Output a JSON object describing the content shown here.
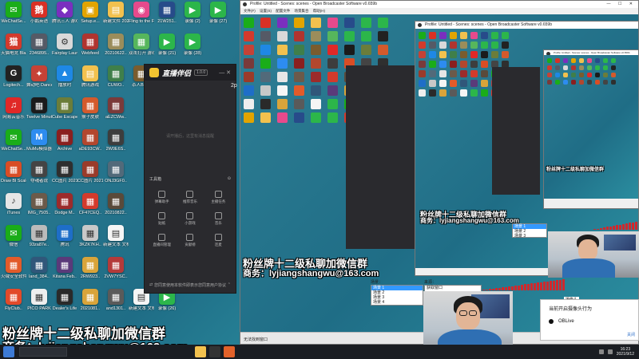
{
  "desktop_icons": [
    {
      "label": "WeChatSe...",
      "color": "#1aad19",
      "glyph": "✉",
      "col": 0,
      "row": 0
    },
    {
      "label": "小鹅英语",
      "color": "#d93025",
      "glyph": "鹅",
      "col": 1,
      "row": 0
    },
    {
      "label": "腾讯三人 游戏 (2)",
      "color": "#7a2fbf",
      "glyph": "◆",
      "col": 2,
      "row": 0
    },
    {
      "label": "Setup.e...",
      "color": "#e2a400",
      "glyph": "▣",
      "col": 3,
      "row": 0
    },
    {
      "label": "新建文件 2021062...",
      "color": "#f2c14e",
      "glyph": "▤",
      "col": 4,
      "row": 0
    },
    {
      "label": "Fling to the Finish 2...",
      "color": "#e64a8c",
      "glyph": "◉",
      "col": 5,
      "row": 0
    },
    {
      "label": "21W251..",
      "color": "#274b8a",
      "glyph": "▦",
      "col": 6,
      "row": 0
    },
    {
      "label": "录像 (2)",
      "color": "#2cb64a",
      "glyph": "▶",
      "col": 7,
      "row": 0
    },
    {
      "label": "录像 (27)",
      "color": "#2cb64a",
      "glyph": "▶",
      "col": 8,
      "row": 0
    },
    {
      "label": "天猫电竞 Blazing...",
      "color": "#d33a2c",
      "glyph": "猫",
      "col": 0,
      "row": 1
    },
    {
      "label": "2346895..",
      "color": "#555a66",
      "glyph": "▦",
      "col": 1,
      "row": 1
    },
    {
      "label": "Fairplay Launcher v...",
      "color": "#d9d9d9",
      "glyph": "⚙",
      "col": 2,
      "row": 1
    },
    {
      "label": "Webfeed",
      "color": "#b0342f",
      "glyph": "▦",
      "col": 3,
      "row": 1
    },
    {
      "label": "20210622..",
      "color": "#9b8d5b",
      "glyph": "▦",
      "col": 4,
      "row": 1
    },
    {
      "label": "双击打开 游戏...",
      "color": "#56b65c",
      "glyph": "▦",
      "col": 5,
      "row": 1
    },
    {
      "label": "录像 (21)",
      "color": "#2cb64a",
      "glyph": "▶",
      "col": 6,
      "row": 1
    },
    {
      "label": "录像 (28)",
      "color": "#2cb64a",
      "glyph": "▶",
      "col": 7,
      "row": 1
    },
    {
      "label": "Logitech...",
      "color": "#222222",
      "glyph": "G",
      "col": 0,
      "row": 2
    },
    {
      "label": "舞动吧 Dance of...",
      "color": "#c64236",
      "glyph": "✦",
      "col": 1,
      "row": 2
    },
    {
      "label": "播放时",
      "color": "#1e88e5",
      "glyph": "▲",
      "col": 2,
      "row": 2
    },
    {
      "label": "腾讯游戏",
      "color": "#f2c14e",
      "glyph": "▤",
      "col": 3,
      "row": 2
    },
    {
      "label": "CUWO..",
      "color": "#3f7f4a",
      "glyph": "▦",
      "col": 4,
      "row": 2
    },
    {
      "label": "杀人Ban..",
      "color": "#7a5c2e",
      "glyph": "▦",
      "col": 5,
      "row": 2
    },
    {
      "label": "网易云音乐",
      "color": "#e02827",
      "glyph": "♫",
      "col": 0,
      "row": 3
    },
    {
      "label": "Twelve Minutes",
      "color": "#1b1b1b",
      "glyph": "▦",
      "col": 1,
      "row": 3
    },
    {
      "label": "Cube Escape",
      "color": "#6b7d3a",
      "glyph": "▦",
      "col": 2,
      "row": 3
    },
    {
      "label": "猴子皮肤",
      "color": "#d35a2c",
      "glyph": "▦",
      "col": 3,
      "row": 3
    },
    {
      "label": "aEZCWw..",
      "color": "#7a3a3a",
      "glyph": "▦",
      "col": 4,
      "row": 3
    },
    {
      "label": "WeChatSe...",
      "color": "#1aad19",
      "glyph": "✉",
      "col": 0,
      "row": 4
    },
    {
      "label": "MuMu模拟器",
      "color": "#2d8cf0",
      "glyph": "M",
      "col": 1,
      "row": 4
    },
    {
      "label": "Archive",
      "color": "#8a1f1f",
      "glyph": "▦",
      "col": 2,
      "row": 4
    },
    {
      "label": "aDE93CW..",
      "color": "#b3472e",
      "glyph": "▦",
      "col": 3,
      "row": 4
    },
    {
      "label": "2W0E6S..",
      "color": "#3d3d3d",
      "glyph": "▦",
      "col": 4,
      "row": 4
    },
    {
      "label": "Draw Bl Scales",
      "color": "#d94d25",
      "glyph": "▦",
      "col": 0,
      "row": 5
    },
    {
      "label": "夺魂者说",
      "color": "#444444",
      "glyph": "▦",
      "col": 1,
      "row": 5
    },
    {
      "label": "CC图片 20210808..",
      "color": "#2f2f2f",
      "glyph": "▦",
      "col": 2,
      "row": 5
    },
    {
      "label": "CC图片 20210808..",
      "color": "#9a3b2a",
      "glyph": "▦",
      "col": 3,
      "row": 5
    },
    {
      "label": "ONJ3GF0..",
      "color": "#526a7a",
      "glyph": "▦",
      "col": 4,
      "row": 5
    },
    {
      "label": "iTunes",
      "color": "#e6e6e6",
      "glyph": "♪",
      "col": 0,
      "row": 6
    },
    {
      "label": "IMG_7505..",
      "color": "#6b5a4a",
      "glyph": "▦",
      "col": 1,
      "row": 6
    },
    {
      "label": "Dodge M..",
      "color": "#9c2b2b",
      "glyph": "▦",
      "col": 2,
      "row": 6
    },
    {
      "label": "CF47CEQ..",
      "color": "#d33a2c",
      "glyph": "▦",
      "col": 3,
      "row": 6
    },
    {
      "label": "20210822..",
      "color": "#5a4a3a",
      "glyph": "▦",
      "col": 4,
      "row": 6
    },
    {
      "label": "微信",
      "color": "#1aad19",
      "glyph": "✉",
      "col": 0,
      "row": 7
    },
    {
      "label": "93za87e..",
      "color": "#bbbbbb",
      "glyph": "▦",
      "col": 1,
      "row": 7
    },
    {
      "label": "腾讯",
      "color": "#1e6ec8",
      "glyph": "▦",
      "col": 2,
      "row": 7
    },
    {
      "label": "3KZK7KH..",
      "color": "#c8c8c8",
      "glyph": "▦",
      "col": 3,
      "row": 7
    },
    {
      "label": "新建文本 文档 (3)..",
      "color": "#f5f5f5",
      "glyph": "▤",
      "col": 4,
      "row": 7
    },
    {
      "label": "火绒安全软件",
      "color": "#e25b2a",
      "glyph": "▦",
      "col": 0,
      "row": 8
    },
    {
      "label": "land_384..",
      "color": "#30577a",
      "glyph": "▦",
      "col": 1,
      "row": 8
    },
    {
      "label": "Kitana Feb..",
      "color": "#5a3a7a",
      "glyph": "▦",
      "col": 2,
      "row": 8
    },
    {
      "label": "2RW923..",
      "color": "#d9a43a",
      "glyph": "▦",
      "col": 3,
      "row": 8
    },
    {
      "label": "2VW7YSC..",
      "color": "#b43a3a",
      "glyph": "▦",
      "col": 4,
      "row": 8
    },
    {
      "label": "FlyClub..",
      "color": "#e24a2a",
      "glyph": "▦",
      "col": 0,
      "row": 9
    },
    {
      "label": "PICO PARK",
      "color": "#eeeeee",
      "glyph": "▦",
      "col": 1,
      "row": 9
    },
    {
      "label": "Dealer's Life",
      "color": "#2a2a2a",
      "glyph": "▦",
      "col": 2,
      "row": 9
    },
    {
      "label": "2021081..",
      "color": "#d9a43a",
      "glyph": "▦",
      "col": 3,
      "row": 9
    },
    {
      "label": "and1301..",
      "color": "#5a5a5a",
      "glyph": "▦",
      "col": 4,
      "row": 9
    },
    {
      "label": "新建文本 文档 (4)..",
      "color": "#f5f5f5",
      "glyph": "▤",
      "col": 5,
      "row": 9
    },
    {
      "label": "录像 (26)",
      "color": "#2cb64a",
      "glyph": "▶",
      "col": 6,
      "row": 9
    }
  ],
  "assistant": {
    "app_name": "直播伴侣",
    "version": "1.0.0",
    "notice": "请开播后，这里有消息提醒",
    "tools_title": "工具箱",
    "tools": [
      "弹幕助手",
      "推荐音乐",
      "主播任务",
      "贴纸",
      "小游戏",
      "音乐",
      "直播间管理",
      "贡献榜",
      "连麦"
    ],
    "footer": "您同意使用本软件即表示您同意用户协议",
    "side_label": "2p"
  },
  "obs": {
    "title": "Profile: Untitled - Scenes: scenes - Open Broadcaster Software v0.659b",
    "menu": "文件(F)  设置(S)  配置文件  场景集合  帮助(H)",
    "scenes_label": "场景：",
    "scenes": [
      "场景 1",
      "场景 2",
      "场景 3",
      "场景 4"
    ],
    "sources_label": "来源：",
    "sources": [
      "获取窗口"
    ],
    "status": "无法找到窗口"
  },
  "overlay": {
    "line1": "粉丝牌十二级私聊加微信群",
    "line2": "商务：lyjiangshangwu@163.com"
  },
  "camera_popup": {
    "title": "摄像头",
    "question": "当前开启摄像头行为",
    "option": "OBLive",
    "link": "关闭"
  },
  "taskbar": {
    "search_placeholder": "",
    "time": "16:23",
    "date": "2021/9/12"
  },
  "colors": {
    "desktop_bg": "#2f7f95",
    "assistant_bg": "#2a2a2e",
    "meter": "#d0282c",
    "selection": "#3399ff"
  }
}
